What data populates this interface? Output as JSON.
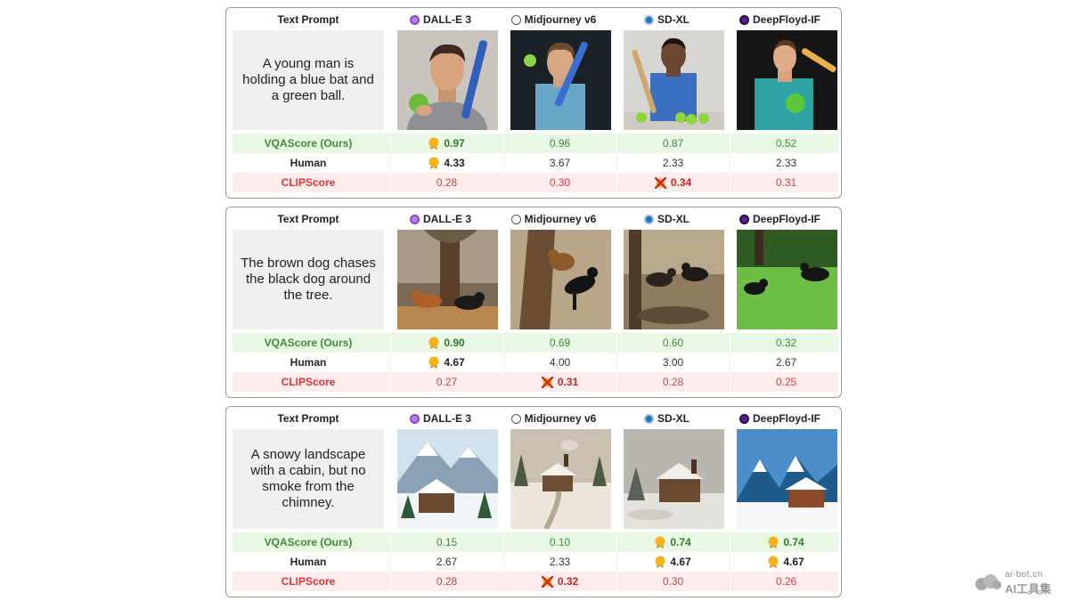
{
  "header": {
    "prompt_col": "Text Prompt",
    "models": [
      {
        "name": "DALL-E 3",
        "icon": "dalle-icon",
        "color": "#9b59d6"
      },
      {
        "name": "Midjourney v6",
        "icon": "midjourney-icon",
        "color": "#555555"
      },
      {
        "name": "SD-XL",
        "icon": "sdxl-icon",
        "color": "#2f6fb0"
      },
      {
        "name": "DeepFloyd-IF",
        "icon": "deepfloyd-icon",
        "color": "#6a2b9e"
      }
    ]
  },
  "metric_labels": {
    "vqa": "VQAScore (Ours)",
    "human": "Human",
    "clip": "CLIPScore"
  },
  "colors": {
    "vqa_bg": "#e8f8e4",
    "clip_bg": "#fdecec",
    "medal": "#f2b21b",
    "x_mark": "#c62828"
  },
  "panels": [
    {
      "prompt": "A young man is holding a blue bat and a green ball.",
      "vqa": [
        "0.97",
        "0.96",
        "0.87",
        "0.52"
      ],
      "human": [
        "4.33",
        "3.67",
        "2.33",
        "2.33"
      ],
      "clip": [
        "0.28",
        "0.30",
        "0.34",
        "0.31"
      ]
    },
    {
      "prompt": "The brown dog chases the black dog around the tree.",
      "vqa": [
        "0.90",
        "0.69",
        "0.60",
        "0.32"
      ],
      "human": [
        "4.67",
        "4.00",
        "3.00",
        "2.67"
      ],
      "clip": [
        "0.27",
        "0.31",
        "0.28",
        "0.25"
      ]
    },
    {
      "prompt": "A snowy landscape with a cabin, but no smoke from the chimney.",
      "vqa": [
        "0.15",
        "0.10",
        "0.74",
        "0.74"
      ],
      "human": [
        "2.67",
        "2.33",
        "4.67",
        "4.67"
      ],
      "clip": [
        "0.28",
        "0.32",
        "0.30",
        "0.26"
      ]
    }
  ],
  "watermark": {
    "line1": "ai-bot.cn",
    "line2": "AI工具集"
  }
}
